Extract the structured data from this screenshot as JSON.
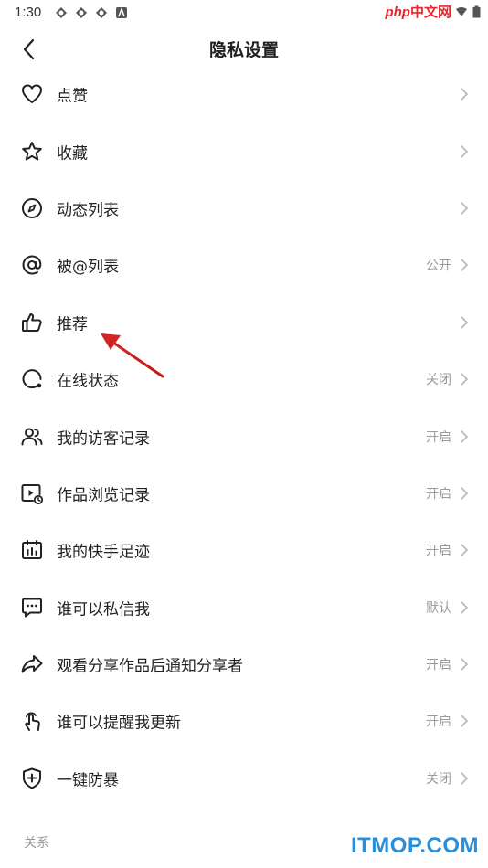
{
  "status_bar": {
    "time": "1:30"
  },
  "watermark_top": {
    "php": "php",
    "cn": "中文网"
  },
  "header": {
    "title": "隐私设置"
  },
  "items": [
    {
      "label": "点赞",
      "value": "",
      "icon": "heart-icon"
    },
    {
      "label": "收藏",
      "value": "",
      "icon": "star-icon"
    },
    {
      "label": "动态列表",
      "value": "",
      "icon": "compass-icon"
    },
    {
      "label": "被@列表",
      "value": "公开",
      "icon": "at-icon"
    },
    {
      "label": "推荐",
      "value": "",
      "icon": "thumbs-up-icon"
    },
    {
      "label": "在线状态",
      "value": "关闭",
      "icon": "online-status-icon"
    },
    {
      "label": "我的访客记录",
      "value": "开启",
      "icon": "visitors-icon"
    },
    {
      "label": "作品浏览记录",
      "value": "开启",
      "icon": "video-history-icon"
    },
    {
      "label": "我的快手足迹",
      "value": "开启",
      "icon": "calendar-icon"
    },
    {
      "label": "谁可以私信我",
      "value": "默认",
      "icon": "message-icon"
    },
    {
      "label": "观看分享作品后通知分享者",
      "value": "开启",
      "icon": "share-icon"
    },
    {
      "label": "谁可以提醒我更新",
      "value": "开启",
      "icon": "tap-hand-icon"
    },
    {
      "label": "一键防暴",
      "value": "关闭",
      "icon": "shield-plus-icon"
    }
  ],
  "section": {
    "label": "关系"
  },
  "watermark_bottom": "ITMOP.COM",
  "colors": {
    "annotation_arrow": "#d32424",
    "watermark_blue": "#2a8fd8"
  }
}
